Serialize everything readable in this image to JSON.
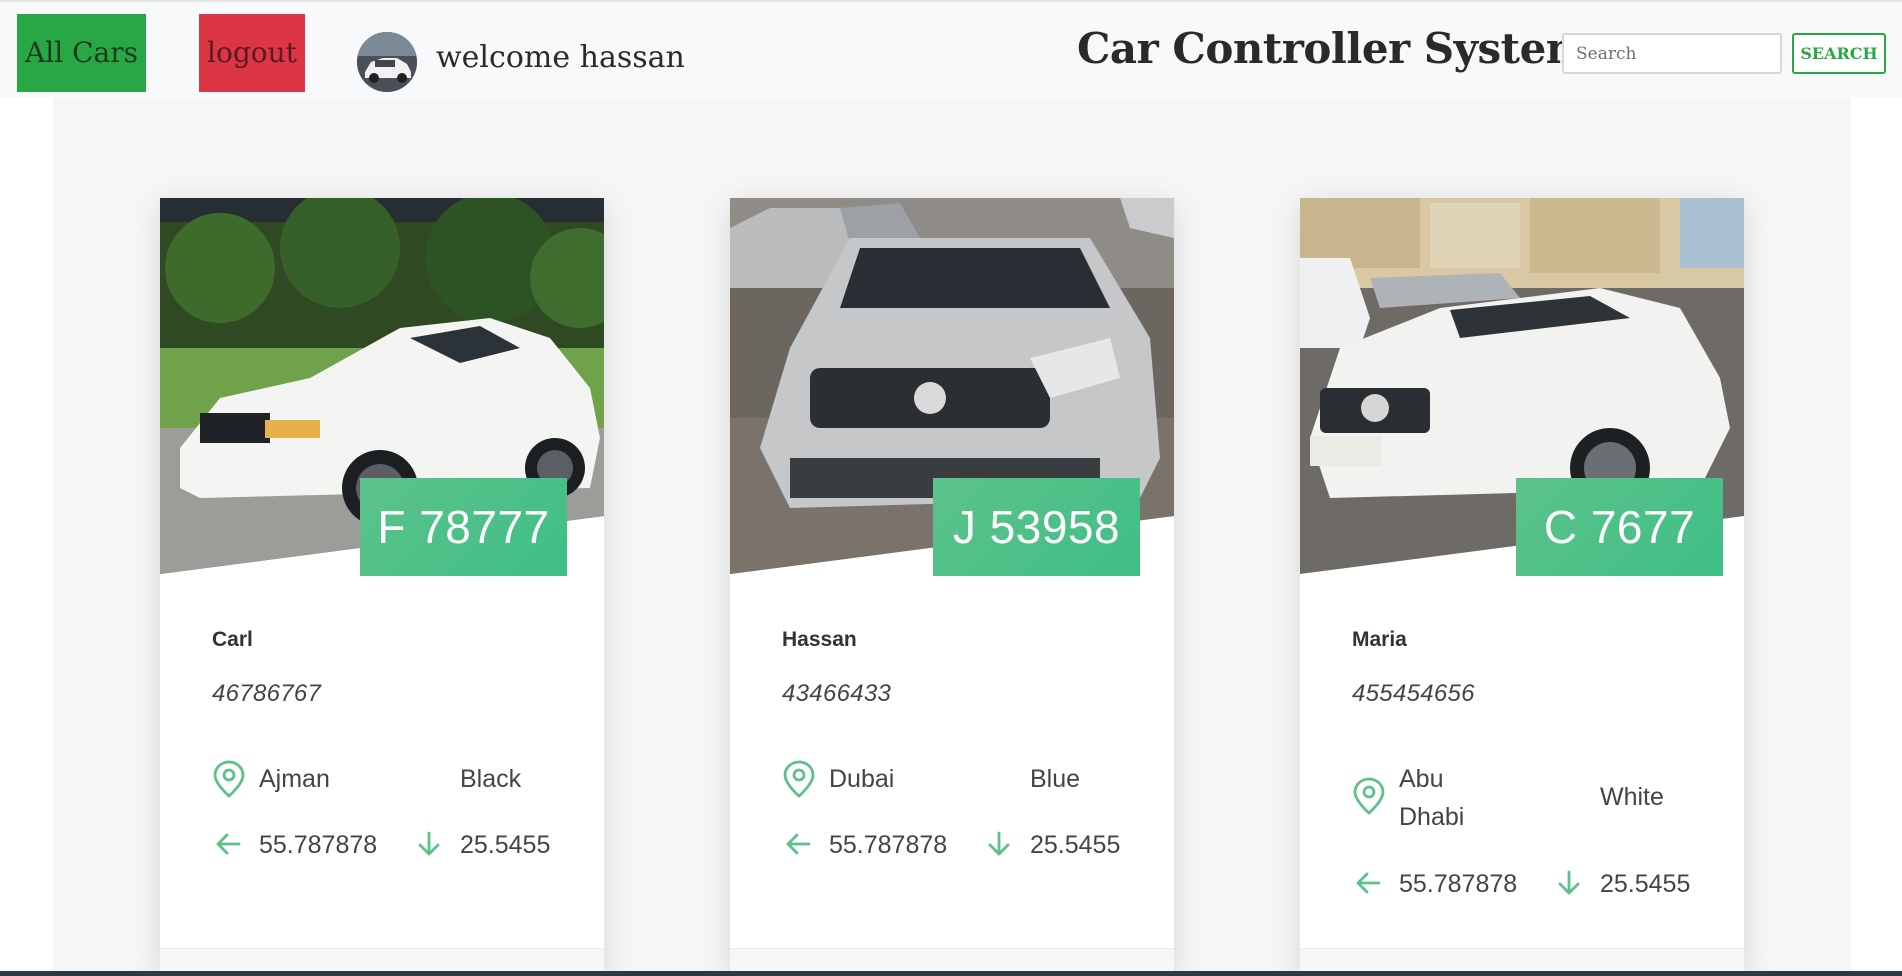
{
  "navbar": {
    "all_cars_label": "All Cars",
    "logout_label": "logout",
    "welcome_text": "welcome hassan",
    "brand_title": "Car Controller System",
    "search_placeholder": "Search",
    "search_value": "",
    "search_button_label": "SEARCH"
  },
  "colors": {
    "success": "#28a745",
    "danger": "#dc3545",
    "plate_gradient_start": "#5cc28a",
    "plate_gradient_end": "#3fbf86",
    "icon_green": "#5cc28a"
  },
  "cars": [
    {
      "plate": "F 78777",
      "owner": "Carl",
      "phone": "46786767",
      "location": "Ajman",
      "color": "Black",
      "longitude": "55.787878",
      "latitude": "25.5455",
      "photo": "white BMW coupe"
    },
    {
      "plate": "J 53958",
      "owner": "Hassan",
      "phone": "43466433",
      "location": "Dubai",
      "color": "Blue",
      "longitude": "55.787878",
      "latitude": "25.5455",
      "photo": "silver Nissan sedan"
    },
    {
      "plate": "C 7677",
      "owner": "Maria",
      "phone": "455454656",
      "location": "Abu Dhabi",
      "color": "White",
      "longitude": "55.787878",
      "latitude": "25.5455",
      "photo": "white Volkswagen sedan"
    }
  ],
  "icons": {
    "location": "map-pin-icon",
    "longitude": "arrow-left-icon",
    "latitude": "arrow-down-icon"
  }
}
